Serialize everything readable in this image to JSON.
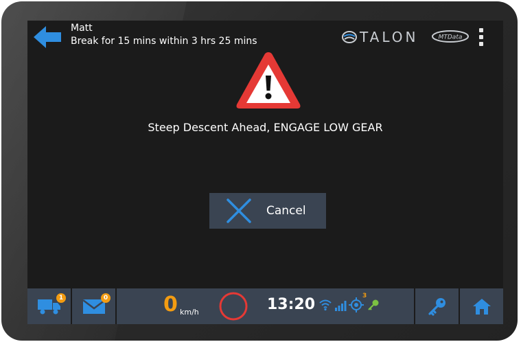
{
  "header": {
    "driver_name": "Matt",
    "break_notice": "Break for 15 mins within 3 hrs 25 mins",
    "brand_logo": "TALON",
    "partner_logo": "MTData"
  },
  "alert": {
    "icon": "warning-triangle-icon",
    "message": "Steep Descent Ahead, ENGAGE LOW GEAR",
    "cancel_label": "Cancel"
  },
  "bottom_bar": {
    "truck_badge": "1",
    "mail_badge": "0",
    "speed_value": "0",
    "speed_unit": "km/h",
    "time": "13:20",
    "gps_badge": "3"
  },
  "colors": {
    "accent_blue": "#2f8ee0",
    "alert_red": "#e53935",
    "badge_orange": "#f39c12",
    "bar_bg": "#3a4452",
    "screen_bg": "#1b1b1b",
    "status_green": "#7cc242"
  }
}
